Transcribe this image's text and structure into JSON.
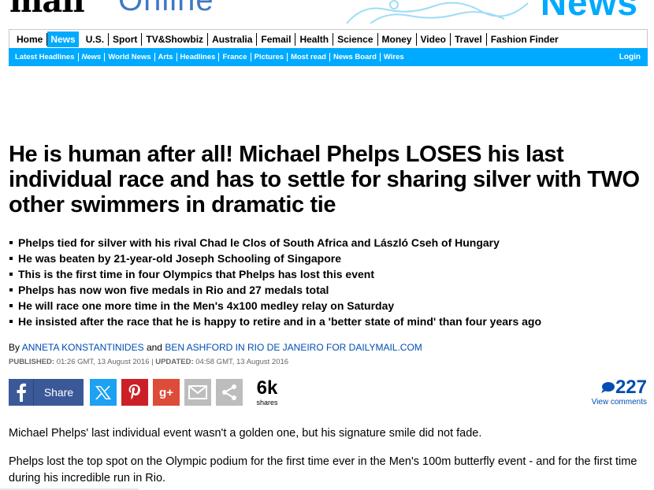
{
  "masthead": {
    "logo_main": "mail",
    "logo_suffix": "Online",
    "section_title": "News"
  },
  "nav_primary": [
    {
      "label": "Home",
      "active": false
    },
    {
      "label": "News",
      "active": true
    },
    {
      "label": "U.S.",
      "active": false
    },
    {
      "label": "Sport",
      "active": false
    },
    {
      "label": "TV&Showbiz",
      "active": false
    },
    {
      "label": "Australia",
      "active": false
    },
    {
      "label": "Femail",
      "active": false
    },
    {
      "label": "Health",
      "active": false
    },
    {
      "label": "Science",
      "active": false
    },
    {
      "label": "Money",
      "active": false
    },
    {
      "label": "Video",
      "active": false
    },
    {
      "label": "Travel",
      "active": false
    },
    {
      "label": "Fashion Finder",
      "active": false
    }
  ],
  "nav_secondary": [
    {
      "label": "Latest Headlines"
    },
    {
      "label": "News"
    },
    {
      "label": "World News"
    },
    {
      "label": "Arts"
    },
    {
      "label": "Headlines"
    },
    {
      "label": "France"
    },
    {
      "label": "Pictures"
    },
    {
      "label": "Most read"
    },
    {
      "label": "News Board"
    },
    {
      "label": "Wires"
    }
  ],
  "login_label": "Login",
  "article": {
    "headline": "He is human after all! Michael Phelps LOSES his last individual race and has to settle for sharing silver with TWO other swimmers in dramatic tie",
    "bullets": [
      "Phelps tied for silver with his rival Chad le Clos of South Africa and László Cseh of Hungary",
      "He was beaten by 21-year-old Joseph Schooling of Singapore",
      "This is the first time in four Olympics that Phelps has lost this event",
      "Phelps has now won five medals in Rio and 27 medals total",
      "He will race one more time in the Men's 4x100 medley relay on Saturday",
      "He insisted after the race that he is happy to retire and in a 'better state of mind' than four years ago"
    ],
    "byline": {
      "prefix": "By ",
      "author1": "ANNETA KONSTANTINIDES",
      "joiner": " and ",
      "author2": "BEN ASHFORD IN RIO DE JANEIRO FOR DAILYMAIL.COM"
    },
    "dateline": {
      "published_label": "PUBLISHED:",
      "published_value": " 01:26 GMT, 13 August 2016 | ",
      "updated_label": "UPDATED:",
      "updated_value": " 04:58 GMT, 13 August 2016"
    },
    "share": {
      "facebook_label": "Share",
      "google_label": "g+",
      "share_count": "6k",
      "share_count_label": "shares",
      "comment_count": "227",
      "comment_label": "View comments"
    },
    "paragraphs": [
      "Michael Phelps' last individual event wasn't a golden one, but his signature smile did not fade.",
      "Phelps lost the top spot on the Olympic podium for the first time ever in the Men's 100m butterfly event - and for the first time during his incredible run in Rio."
    ]
  },
  "colors": {
    "accent": "#00aaff",
    "link": "#004db3",
    "facebook": "#3b5998",
    "twitter": "#1da1f2",
    "pinterest": "#cb2027",
    "googleplus": "#dd4b39",
    "grey_button": "#bdbdbd"
  }
}
